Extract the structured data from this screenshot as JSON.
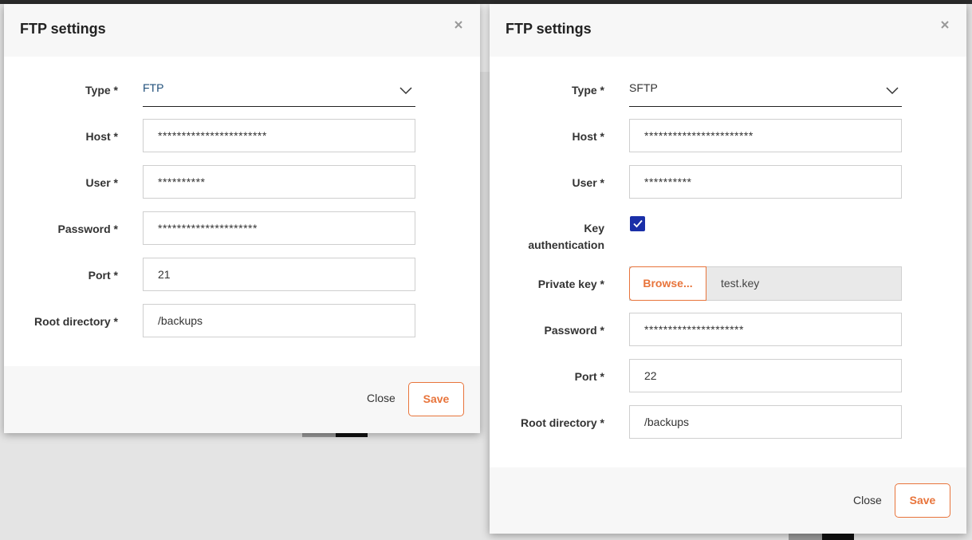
{
  "left_dialog": {
    "title": "FTP settings",
    "labels": {
      "type": "Type *",
      "host": "Host *",
      "user": "User *",
      "password": "Password *",
      "port": "Port *",
      "root": "Root directory *"
    },
    "type_value": "FTP",
    "host_value": "***********************",
    "user_value": "**********",
    "password_value": "*********************",
    "port_value": "21",
    "root_value": "/backups",
    "close_label": "Close",
    "save_label": "Save"
  },
  "right_dialog": {
    "title": "FTP settings",
    "labels": {
      "type": "Type *",
      "host": "Host *",
      "user": "User *",
      "key_auth_line1": "Key",
      "key_auth_line2": "authentication",
      "private_key": "Private key *",
      "password": "Password *",
      "port": "Port *",
      "root": "Root directory *"
    },
    "type_value": "SFTP",
    "host_value": "***********************",
    "user_value": "**********",
    "key_auth_checked": true,
    "browse_label": "Browse...",
    "file_name": "test.key",
    "password_value": "*********************",
    "port_value": "22",
    "root_value": "/backups",
    "close_label": "Close",
    "save_label": "Save"
  },
  "colors": {
    "accent": "#e8743b",
    "checkbox": "#1a2fa8",
    "select_value_ftp": "#1f4f7a"
  },
  "icons": {
    "close": "close-icon",
    "dropdown": "chevron-down-icon",
    "checkmark": "checkmark-icon"
  }
}
